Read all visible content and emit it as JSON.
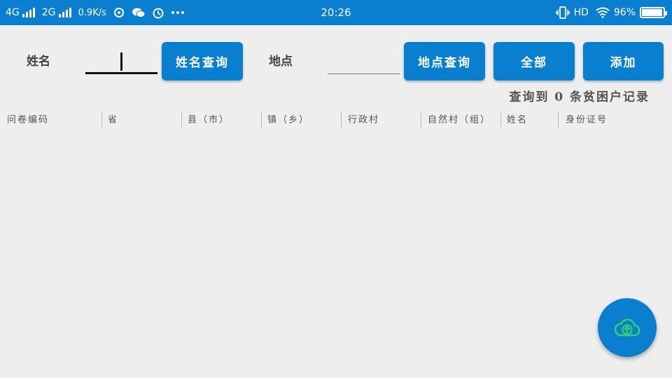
{
  "status_bar": {
    "network1": "4G",
    "network2": "2G",
    "speed": "0.9K/s",
    "time": "20:26",
    "hd": "HD",
    "battery_text": "96%",
    "battery_level": 0.96,
    "icons": [
      "signal-icon",
      "signal-icon",
      "sync-icon",
      "wechat-icon",
      "alarm-icon",
      "more-icon",
      "vibrate-icon",
      "wifi-icon",
      "battery-icon"
    ]
  },
  "search": {
    "name_label": "姓名",
    "name_value": "",
    "name_button": "姓名查询",
    "place_label": "地点",
    "place_value": "",
    "place_button": "地点查询",
    "all_button": "全部",
    "add_button": "添加"
  },
  "result_text": "查询到 0 条贫困户记录",
  "table": {
    "columns": [
      "问卷编码",
      "省",
      "县（市）",
      "镇（乡）",
      "行政村",
      "自然村（组）",
      "姓名",
      "身份证号"
    ],
    "rows": []
  },
  "fab": {
    "icon": "cloud-upload-icon"
  },
  "colors": {
    "primary": "#0a7fcf",
    "background": "#eeeeee",
    "fab_icon": "#33d36a"
  }
}
